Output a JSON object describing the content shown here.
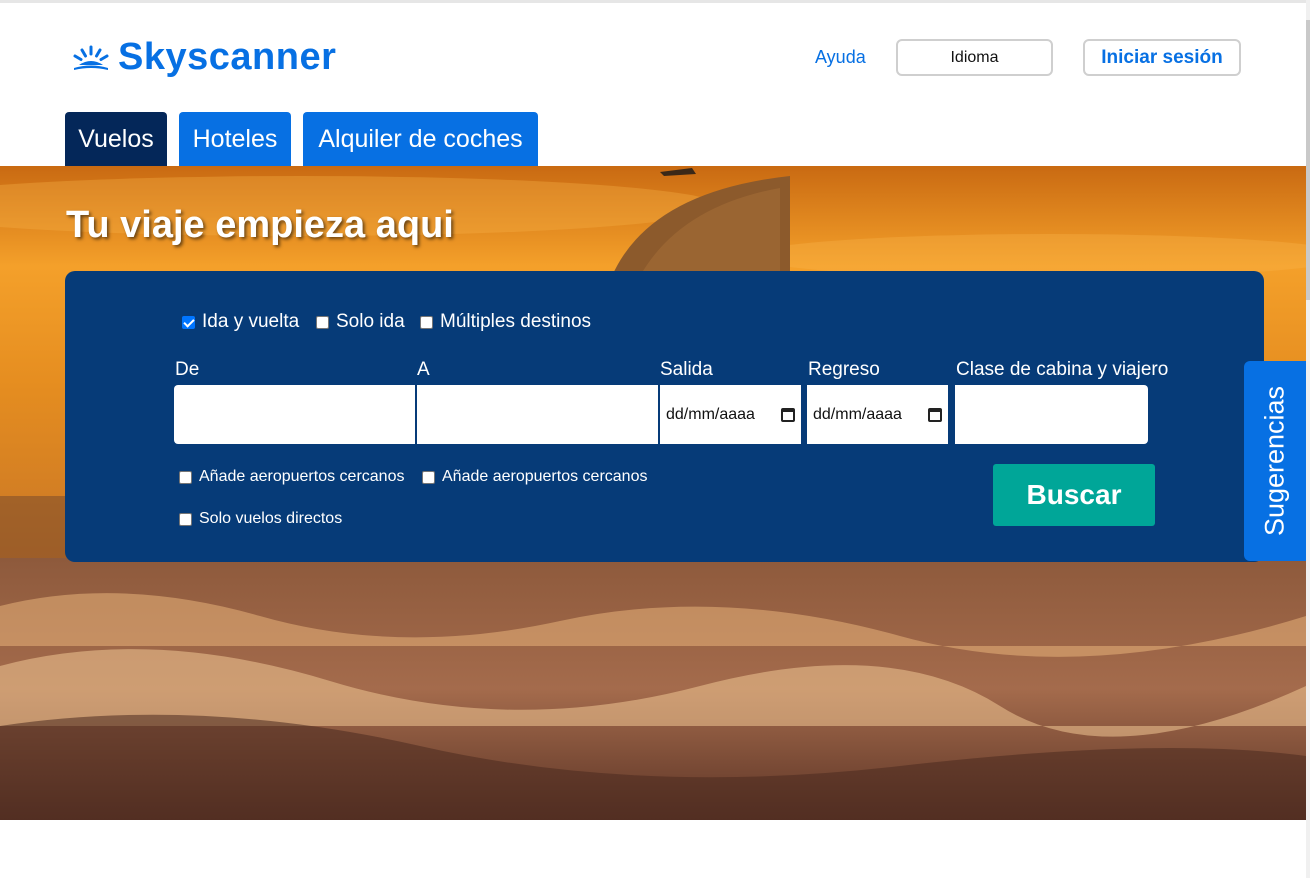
{
  "header": {
    "brand": "Skyscanner",
    "help": "Ayuda",
    "language": "Idioma",
    "login": "Iniciar sesión"
  },
  "tabs": [
    {
      "label": "Vuelos",
      "active": true
    },
    {
      "label": "Hoteles",
      "active": false
    },
    {
      "label": "Alquiler de coches",
      "active": false
    }
  ],
  "hero": {
    "headline": "Tu viaje empieza aqui"
  },
  "search": {
    "trip_types": [
      {
        "label": "Ida y vuelta",
        "checked": true
      },
      {
        "label": "Solo ida",
        "checked": false
      },
      {
        "label": "Múltiples destinos",
        "checked": false
      }
    ],
    "fields": {
      "from": {
        "label": "De",
        "value": ""
      },
      "to": {
        "label": "A",
        "value": ""
      },
      "departure": {
        "label": "Salida",
        "value": "dd/mm/aaaa"
      },
      "return": {
        "label": "Regreso",
        "value": "dd/mm/aaaa"
      },
      "cabin": {
        "label": "Clase de cabina y viajero",
        "value": ""
      }
    },
    "options": [
      {
        "label": "Añade aeropuertos cercanos",
        "checked": false
      },
      {
        "label": "Añade aeropuertos cercanos",
        "checked": false
      },
      {
        "label": "Solo vuelos directos",
        "checked": false
      }
    ],
    "submit": "Buscar"
  },
  "feedback_tab": "Sugerencias",
  "colors": {
    "brand_blue": "#0770e3",
    "active_tab": "#042759",
    "panel": "#063b78",
    "search_button": "#00a698"
  }
}
